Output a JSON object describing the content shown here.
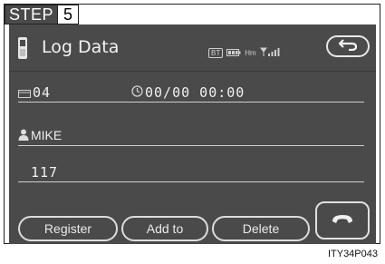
{
  "step": {
    "word": "STEP",
    "number": "5"
  },
  "screen": {
    "title": "Log Data",
    "status": {
      "bt": "BT",
      "roam": "Hm"
    },
    "log_entry": {
      "index": "04",
      "datetime": "00/00 00:00",
      "contact_name": "MIKE",
      "number": "117"
    },
    "buttons": {
      "register": "Register",
      "add_to": "Add to",
      "delete": "Delete"
    }
  },
  "caption": "ITY34P043",
  "colors": {
    "screen_bg": "#4a4a4a",
    "text": "#f0f0f0",
    "outline": "#dcdcdc"
  }
}
